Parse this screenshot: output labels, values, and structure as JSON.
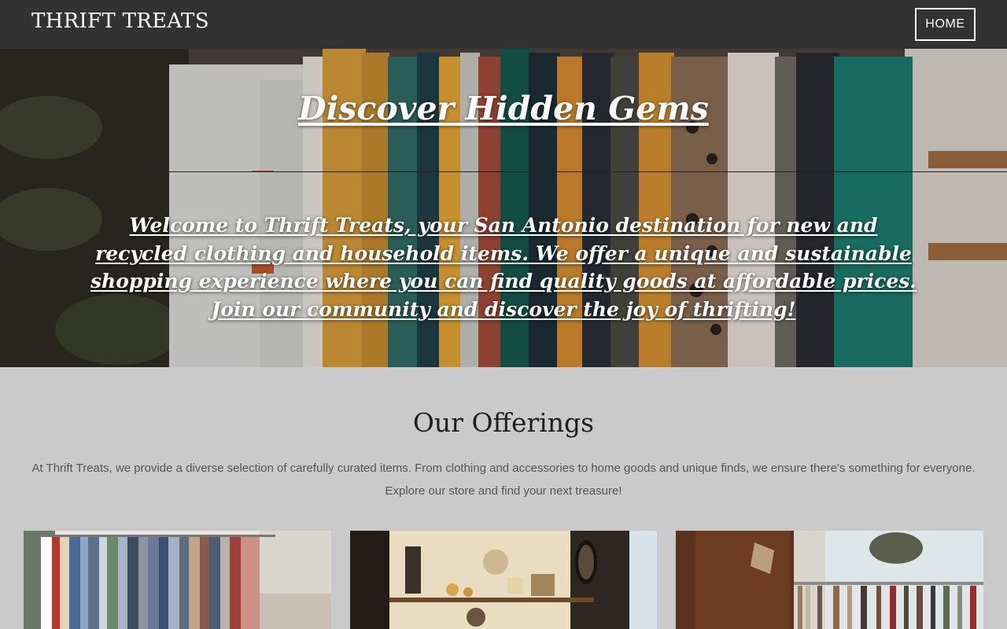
{
  "nav": {
    "brand": "THRIFT TREATS",
    "home_label": "HOME"
  },
  "hero": {
    "heading": "Discover Hidden Gems",
    "text": "Welcome to Thrift Treats, your San Antonio destination for new and recycled clothing and household items. We offer a unique and sustainable shopping experience where you can find quality goods at affordable prices. Join our community and discover the joy of thrifting!"
  },
  "offerings": {
    "title": "Our Offerings",
    "description": "At Thrift Treats, we provide a diverse selection of carefully curated items. From clothing and accessories to home goods and unique finds, we ensure there's something for everyone. Explore our store and find your next treasure!"
  },
  "colors": {
    "nav_background": "#323232",
    "page_background": "#cacaca",
    "text_dark": "#1e1e1e",
    "text_muted": "#555555"
  }
}
